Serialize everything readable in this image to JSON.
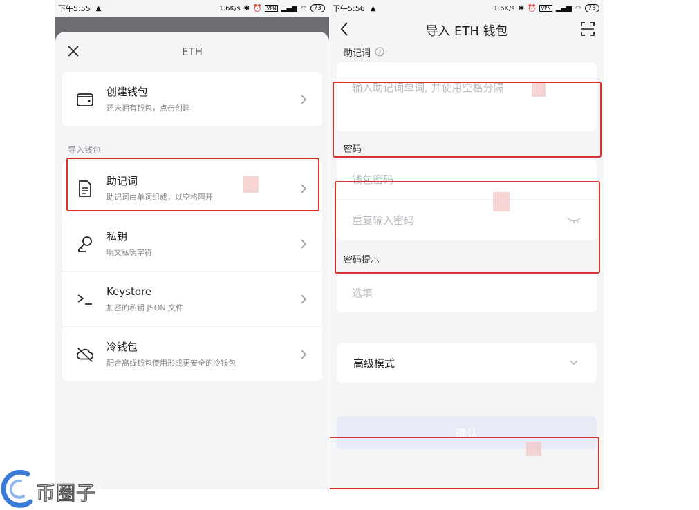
{
  "left": {
    "status": {
      "time": "下午5:55",
      "speed": "1.6K/s",
      "battery": "73",
      "vpn": "VPN"
    },
    "sheet_title": "ETH",
    "create": {
      "label": "创建钱包",
      "sub": "还未拥有钱包，点击创建"
    },
    "import_section": "导入钱包",
    "options": [
      {
        "label": "助记词",
        "sub": "助记词由单词组成，以空格隔开",
        "icon": "document-icon"
      },
      {
        "label": "私钥",
        "sub": "明文私钥字符",
        "icon": "key-icon"
      },
      {
        "label": "Keystore",
        "sub": "加密的私钥 JSON 文件",
        "icon": "terminal-icon"
      },
      {
        "label": "冷钱包",
        "sub": "配合离线钱包使用形成更安全的冷钱包",
        "icon": "cloud-off-icon"
      }
    ]
  },
  "right": {
    "status": {
      "time": "下午5:56",
      "speed": "1.6K/s",
      "battery": "73",
      "vpn": "VPN"
    },
    "title": "导入 ETH 钱包",
    "mnemonic": {
      "label": "助记词",
      "placeholder": "输入助记词单词, 并使用空格分隔"
    },
    "password": {
      "label": "密码",
      "placeholder": "钱包密码",
      "repeat_placeholder": "重复输入密码"
    },
    "hint": {
      "label": "密码提示",
      "placeholder": "选填"
    },
    "advanced": {
      "label": "高级模式"
    },
    "confirm": "确认"
  },
  "watermark": {
    "text": "币圈子",
    "accent": "#3a7bd5"
  },
  "colors": {
    "highlight": "#d9342b",
    "background": "#f4f5f7",
    "confirm_bg": "#e8ebf6"
  }
}
